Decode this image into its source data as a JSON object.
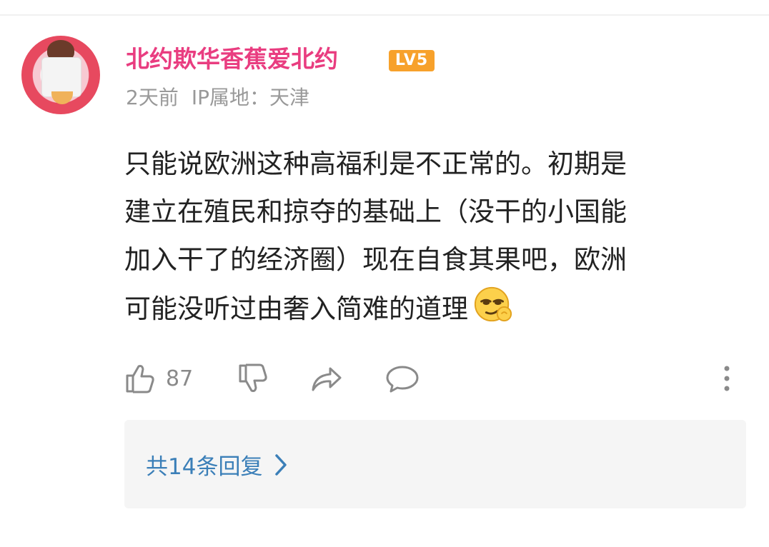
{
  "comment": {
    "author": {
      "name": "北约欺华香蕉爱北约",
      "level_badge": "LV5",
      "badge_color": "#f7a12b",
      "name_color": "#e93d80"
    },
    "time": "2天前",
    "ip_location": "IP属地：天津",
    "body_lines": [
      "只能说欧洲这种高福利是不正常的。初期是",
      "建立在殖民和掠夺的基础上（没干的小国能",
      "加入干了的经济圈）现在自食其果吧，欧洲",
      "可能没听过由奢入简难的道理"
    ],
    "emoji": "smug-face-emoji",
    "actions": {
      "like_icon": "thumbs-up-icon",
      "like_count": "87",
      "dislike_icon": "thumbs-down-icon",
      "share_icon": "share-icon",
      "reply_icon": "comment-bubble-icon",
      "more_icon": "more-vertical-icon"
    },
    "replies": {
      "label": "共14条回复",
      "icon": "chevron-right-icon",
      "link_color": "#3b7fb8"
    }
  }
}
